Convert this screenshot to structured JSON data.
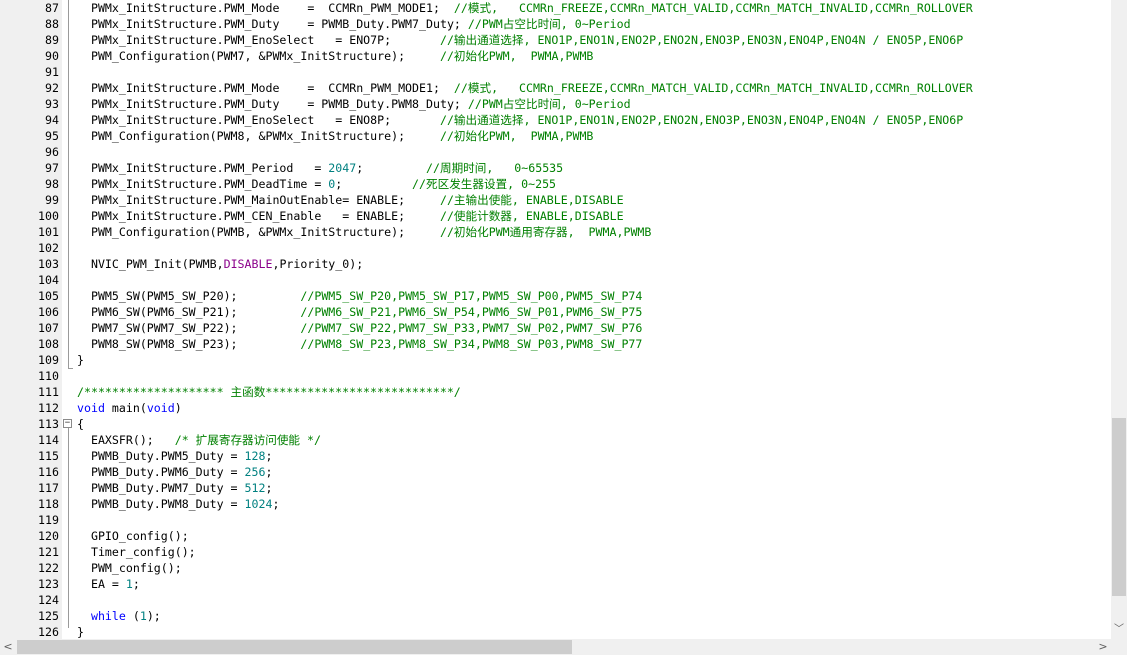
{
  "editor": {
    "lines": [
      {
        "n": "87",
        "segs": [
          [
            "p",
            "  PWMx_InitStructure.PWM_Mode    =  CCMRn_PWM_MODE1;  "
          ],
          [
            "c",
            "//模式,   CCMRn_FREEZE,CCMRn_MATCH_VALID,CCMRn_MATCH_INVALID,CCMRn_ROLLOVER"
          ]
        ]
      },
      {
        "n": "88",
        "segs": [
          [
            "p",
            "  PWMx_InitStructure.PWM_Duty    = PWMB_Duty.PWM7_Duty; "
          ],
          [
            "c",
            "//PWM占空比时间, 0~Period"
          ]
        ]
      },
      {
        "n": "89",
        "segs": [
          [
            "p",
            "  PWMx_InitStructure.PWM_EnoSelect   = ENO7P;       "
          ],
          [
            "c",
            "//输出通道选择, ENO1P,ENO1N,ENO2P,ENO2N,ENO3P,ENO3N,ENO4P,ENO4N / ENO5P,ENO6P"
          ]
        ]
      },
      {
        "n": "90",
        "segs": [
          [
            "p",
            "  PWM_Configuration(PWM7, &PWMx_InitStructure);     "
          ],
          [
            "c",
            "//初始化PWM,  PWMA,PWMB"
          ]
        ]
      },
      {
        "n": "91",
        "segs": []
      },
      {
        "n": "92",
        "segs": [
          [
            "p",
            "  PWMx_InitStructure.PWM_Mode    =  CCMRn_PWM_MODE1;  "
          ],
          [
            "c",
            "//模式,   CCMRn_FREEZE,CCMRn_MATCH_VALID,CCMRn_MATCH_INVALID,CCMRn_ROLLOVER"
          ]
        ]
      },
      {
        "n": "93",
        "segs": [
          [
            "p",
            "  PWMx_InitStructure.PWM_Duty    = PWMB_Duty.PWM8_Duty; "
          ],
          [
            "c",
            "//PWM占空比时间, 0~Period"
          ]
        ]
      },
      {
        "n": "94",
        "segs": [
          [
            "p",
            "  PWMx_InitStructure.PWM_EnoSelect   = ENO8P;       "
          ],
          [
            "c",
            "//输出通道选择, ENO1P,ENO1N,ENO2P,ENO2N,ENO3P,ENO3N,ENO4P,ENO4N / ENO5P,ENO6P"
          ]
        ]
      },
      {
        "n": "95",
        "segs": [
          [
            "p",
            "  PWM_Configuration(PWM8, &PWMx_InitStructure);     "
          ],
          [
            "c",
            "//初始化PWM,  PWMA,PWMB"
          ]
        ]
      },
      {
        "n": "96",
        "segs": []
      },
      {
        "n": "97",
        "segs": [
          [
            "p",
            "  PWMx_InitStructure.PWM_Period   = "
          ],
          [
            "n",
            "2047"
          ],
          [
            "p",
            ";         "
          ],
          [
            "c",
            "//周期时间,   0~65535"
          ]
        ]
      },
      {
        "n": "98",
        "segs": [
          [
            "p",
            "  PWMx_InitStructure.PWM_DeadTime = "
          ],
          [
            "n",
            "0"
          ],
          [
            "p",
            ";          "
          ],
          [
            "c",
            "//死区发生器设置, 0~255"
          ]
        ]
      },
      {
        "n": "99",
        "segs": [
          [
            "p",
            "  PWMx_InitStructure.PWM_MainOutEnable= ENABLE;     "
          ],
          [
            "c",
            "//主输出使能, ENABLE,DISABLE"
          ]
        ]
      },
      {
        "n": "100",
        "segs": [
          [
            "p",
            "  PWMx_InitStructure.PWM_CEN_Enable   = ENABLE;     "
          ],
          [
            "c",
            "//使能计数器, ENABLE,DISABLE"
          ]
        ]
      },
      {
        "n": "101",
        "segs": [
          [
            "p",
            "  PWM_Configuration(PWMB, &PWMx_InitStructure);     "
          ],
          [
            "c",
            "//初始化PWM通用寄存器,  PWMA,PWMB"
          ]
        ]
      },
      {
        "n": "102",
        "segs": []
      },
      {
        "n": "103",
        "segs": [
          [
            "p",
            "  NVIC_PWM_Init(PWMB,"
          ],
          [
            "m",
            "DISABLE"
          ],
          [
            "p",
            ",Priority_0);"
          ]
        ]
      },
      {
        "n": "104",
        "segs": []
      },
      {
        "n": "105",
        "segs": [
          [
            "p",
            "  PWM5_SW(PWM5_SW_P20);         "
          ],
          [
            "c",
            "//PWM5_SW_P20,PWM5_SW_P17,PWM5_SW_P00,PWM5_SW_P74"
          ]
        ]
      },
      {
        "n": "106",
        "segs": [
          [
            "p",
            "  PWM6_SW(PWM6_SW_P21);         "
          ],
          [
            "c",
            "//PWM6_SW_P21,PWM6_SW_P54,PWM6_SW_P01,PWM6_SW_P75"
          ]
        ]
      },
      {
        "n": "107",
        "segs": [
          [
            "p",
            "  PWM7_SW(PWM7_SW_P22);         "
          ],
          [
            "c",
            "//PWM7_SW_P22,PWM7_SW_P33,PWM7_SW_P02,PWM7_SW_P76"
          ]
        ]
      },
      {
        "n": "108",
        "segs": [
          [
            "p",
            "  PWM8_SW(PWM8_SW_P23);         "
          ],
          [
            "c",
            "//PWM8_SW_P23,PWM8_SW_P34,PWM8_SW_P03,PWM8_SW_P77"
          ]
        ]
      },
      {
        "n": "109",
        "segs": [
          [
            "p",
            "}"
          ]
        ]
      },
      {
        "n": "110",
        "segs": []
      },
      {
        "n": "111",
        "segs": [
          [
            "c",
            "/******************** 主函数***************************/"
          ]
        ]
      },
      {
        "n": "112",
        "segs": [
          [
            "k",
            "void"
          ],
          [
            "p",
            " main("
          ],
          [
            "k",
            "void"
          ],
          [
            "p",
            ")"
          ]
        ]
      },
      {
        "n": "113",
        "segs": [
          [
            "p",
            "{"
          ]
        ]
      },
      {
        "n": "114",
        "segs": [
          [
            "p",
            "  EAXSFR();   "
          ],
          [
            "c",
            "/* 扩展寄存器访问使能 */"
          ]
        ]
      },
      {
        "n": "115",
        "segs": [
          [
            "p",
            "  PWMB_Duty.PWM5_Duty = "
          ],
          [
            "n",
            "128"
          ],
          [
            "p",
            ";"
          ]
        ]
      },
      {
        "n": "116",
        "segs": [
          [
            "p",
            "  PWMB_Duty.PWM6_Duty = "
          ],
          [
            "n",
            "256"
          ],
          [
            "p",
            ";"
          ]
        ]
      },
      {
        "n": "117",
        "segs": [
          [
            "p",
            "  PWMB_Duty.PWM7_Duty = "
          ],
          [
            "n",
            "512"
          ],
          [
            "p",
            ";"
          ]
        ]
      },
      {
        "n": "118",
        "segs": [
          [
            "p",
            "  PWMB_Duty.PWM8_Duty = "
          ],
          [
            "n",
            "1024"
          ],
          [
            "p",
            ";"
          ]
        ]
      },
      {
        "n": "119",
        "segs": []
      },
      {
        "n": "120",
        "segs": [
          [
            "p",
            "  GPIO_config();"
          ]
        ]
      },
      {
        "n": "121",
        "segs": [
          [
            "p",
            "  Timer_config();"
          ]
        ]
      },
      {
        "n": "122",
        "segs": [
          [
            "p",
            "  PWM_config();"
          ]
        ]
      },
      {
        "n": "123",
        "segs": [
          [
            "p",
            "  EA = "
          ],
          [
            "n",
            "1"
          ],
          [
            "p",
            ";"
          ]
        ]
      },
      {
        "n": "124",
        "segs": []
      },
      {
        "n": "125",
        "segs": [
          [
            "p",
            "  "
          ],
          [
            "k",
            "while"
          ],
          [
            "p",
            " ("
          ],
          [
            "n",
            "1"
          ],
          [
            "p",
            ");"
          ]
        ]
      },
      {
        "n": "126",
        "segs": [
          [
            "p",
            "}"
          ]
        ]
      }
    ]
  },
  "colors": {
    "keyword": "#0000ff",
    "number": "#008080",
    "macro": "#8b008b",
    "comment": "#008000",
    "plain": "#000000"
  },
  "icons": {
    "scroll_down": "chevron-down-icon",
    "scroll_left": "chevron-left-icon",
    "scroll_right": "chevron-right-icon",
    "fold": "fold-minus-icon"
  },
  "scrollbar_glyphs": {
    "down": "﹀",
    "left": "<",
    "right": ">"
  },
  "fold_glyph": "−"
}
